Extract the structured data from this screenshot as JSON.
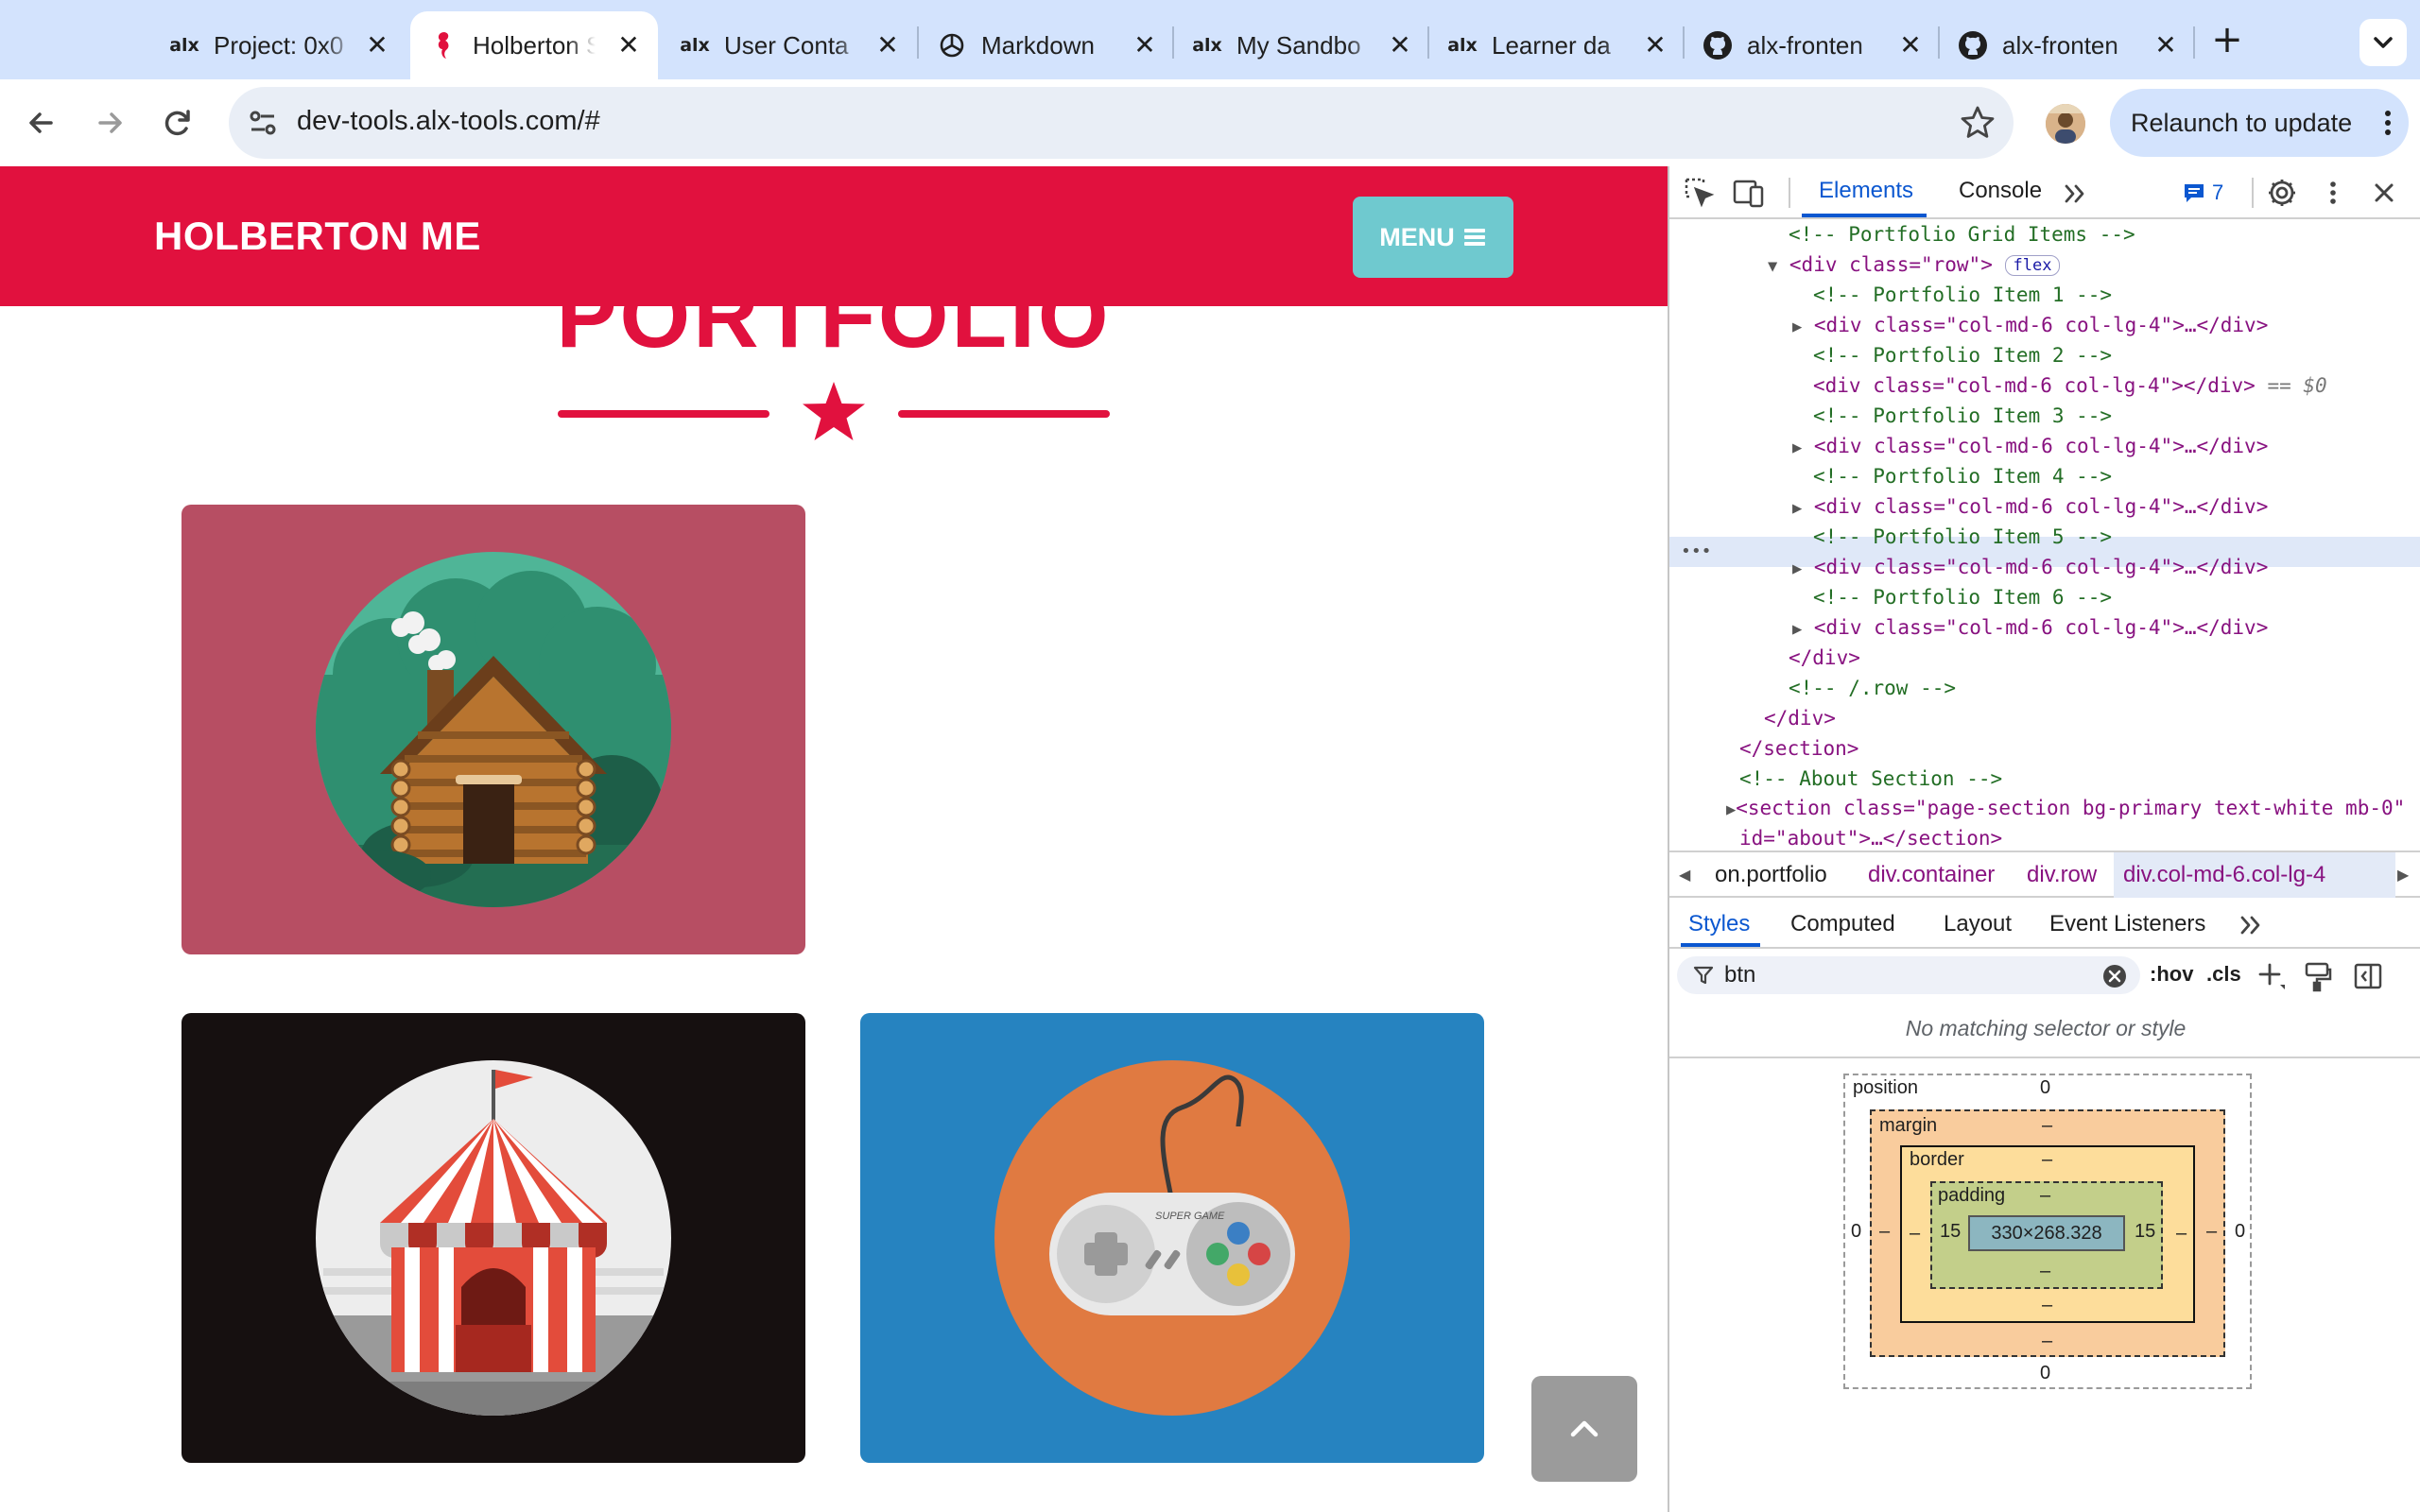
{
  "browser": {
    "tabs": [
      {
        "favicon": "alx",
        "title": "Project: 0x0"
      },
      {
        "favicon": "holberton-seahorse",
        "title": "Holberton S"
      },
      {
        "favicon": "alx",
        "title": "User Conta"
      },
      {
        "favicon": "openai",
        "title": "Markdown"
      },
      {
        "favicon": "alx",
        "title": "My Sandbo"
      },
      {
        "favicon": "alx",
        "title": "Learner da"
      },
      {
        "favicon": "github",
        "title": "alx-fronten"
      },
      {
        "favicon": "github",
        "title": "alx-fronten"
      }
    ],
    "url": "dev-tools.alx-tools.com/#",
    "relaunch_label": "Relaunch to update",
    "new_tab": "+",
    "close_glyph": "✕"
  },
  "site": {
    "brand": "HOLBERTON ME",
    "menu_label": "MENU",
    "section_heading": "PORTFOLIO",
    "colors": {
      "primary": "#e1113e",
      "menu": "#6fc9cf",
      "item1": "#b74e63",
      "item2": "#161010",
      "item3": "#2683c0"
    },
    "items": [
      {
        "image": "log-cabin-illustration"
      },
      {
        "image": "circus-tent-illustration"
      },
      {
        "image": "game-controller-illustration",
        "controller_text": "SUPER GAME"
      }
    ],
    "scroll_top_icon": "chevron-up-icon"
  },
  "devtools": {
    "tabs": [
      "Elements",
      "Console"
    ],
    "issues_count": "7",
    "lines": [
      {
        "text": "<!-- Portfolio Grid Items -->"
      },
      {
        "text": "<div class=\"row\">",
        "badge": "flex"
      },
      {
        "text": "<!-- Portfolio Item 1 -->"
      },
      {
        "text": "<div class=\"col-md-6 col-lg-4\">…</div>"
      },
      {
        "text": "<!-- Portfolio Item 2 -->"
      },
      {
        "text": "<div class=\"col-md-6 col-lg-4\"></div>",
        "suffix": "== $0"
      },
      {
        "text": "<!-- Portfolio Item 3 -->"
      },
      {
        "text": "<div class=\"col-md-6 col-lg-4\">…</div>"
      },
      {
        "text": "<!-- Portfolio Item 4 -->"
      },
      {
        "text": "<div class=\"col-md-6 col-lg-4\">…</div>"
      },
      {
        "text": "<!-- Portfolio Item 5 -->"
      },
      {
        "text": "<div class=\"col-md-6 col-lg-4\">…</div>"
      },
      {
        "text": "<!-- Portfolio Item 6 -->"
      },
      {
        "text": "<div class=\"col-md-6 col-lg-4\">…</div>"
      },
      {
        "text": "</div>"
      },
      {
        "text": "<!-- /.row -->"
      },
      {
        "text": "</div>"
      },
      {
        "text": "</section>"
      },
      {
        "text": "<!-- About Section -->"
      },
      {
        "text": "<section class=\"page-section bg-primary text-white mb-0\" id=\"about\">…</section>"
      }
    ],
    "breadcrumbs": [
      "on.portfolio",
      "div.container",
      "div.row",
      "div.col-md-6.col-lg-4"
    ],
    "style_tabs": [
      "Styles",
      "Computed",
      "Layout",
      "Event Listeners"
    ],
    "filter_value": "btn",
    "hov": ":hov",
    "cls": ".cls",
    "no_match": "No matching selector or style",
    "box_model": {
      "position_label": "position",
      "position_top": "0",
      "position_bottom": "0",
      "position_left": "0",
      "position_right": "0",
      "margin_label": "margin",
      "margin_top": "–",
      "margin_bottom": "–",
      "margin_left": "–",
      "margin_right": "–",
      "border_label": "border",
      "border_top": "–",
      "border_bottom": "–",
      "border_left": "–",
      "border_right": "–",
      "padding_label": "padding",
      "padding_top": "–",
      "padding_bottom": "–",
      "padding_left": "15",
      "padding_right": "15",
      "content": "330×268.328"
    }
  }
}
